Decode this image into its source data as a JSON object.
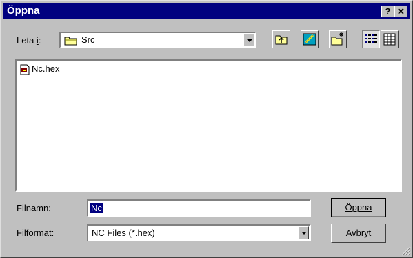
{
  "window": {
    "title": "Öppna",
    "help_label": "?",
    "close_label": "✕"
  },
  "lookin": {
    "label": "Leta i:",
    "value": "Src"
  },
  "files": [
    {
      "name": "Nc.hex"
    }
  ],
  "filename": {
    "label": "Filnamn:",
    "value": "Nc"
  },
  "filetype": {
    "label": "Filformat:",
    "value": "NC Files (*.hex)"
  },
  "buttons": {
    "open_label": "Öppna",
    "cancel_label": "Avbryt"
  }
}
